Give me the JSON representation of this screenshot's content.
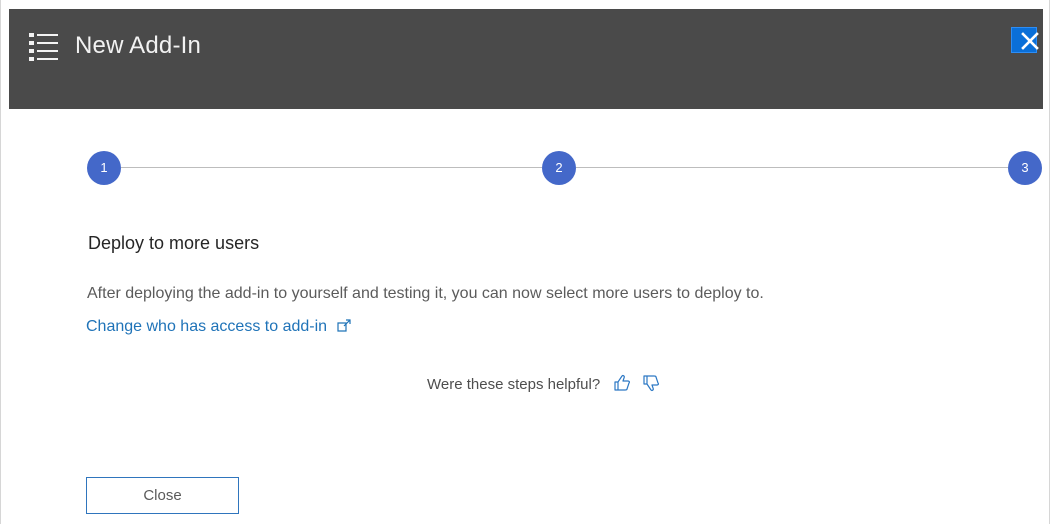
{
  "header": {
    "title": "New Add-In",
    "menu_icon": "list-icon",
    "close_icon": "close-icon",
    "background_color": "#4a4a4a"
  },
  "stepper": {
    "steps": [
      {
        "label": "1"
      },
      {
        "label": "2"
      },
      {
        "label": "3"
      }
    ],
    "accent_color": "#4468c9"
  },
  "content": {
    "title": "Deploy to more users",
    "description": "After deploying the add-in to yourself and testing it, you can now select more users to deploy to.",
    "link_label": "Change who has access to add-in",
    "link_icon": "external-link-icon",
    "link_color": "#1f73b8"
  },
  "feedback": {
    "prompt": "Were these steps helpful?",
    "positive_icon": "thumbs-up-icon",
    "negative_icon": "thumbs-down-icon"
  },
  "footer": {
    "close_label": "Close"
  }
}
